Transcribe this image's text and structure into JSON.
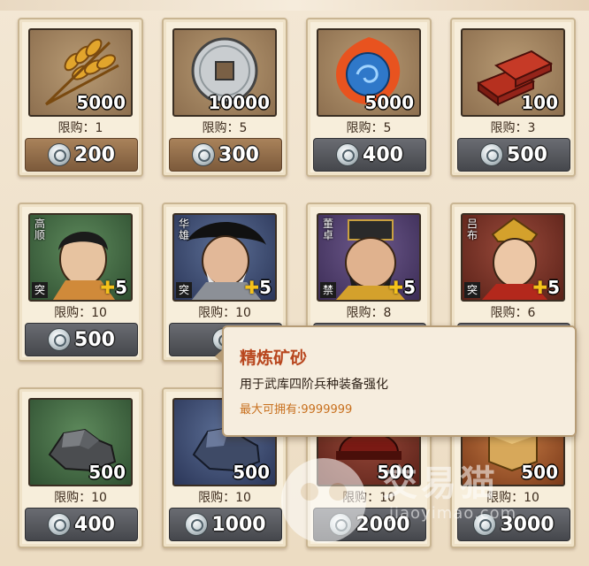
{
  "shop": {
    "items": [
      {
        "id": "wheat",
        "icon": "wheat-icon",
        "qty": "5000",
        "limit": "限购：1",
        "price": "200",
        "btn": "brown"
      },
      {
        "id": "coin",
        "icon": "silver-coin-icon",
        "qty": "10000",
        "limit": "限购：5",
        "price": "300",
        "btn": "brown"
      },
      {
        "id": "fire-orb",
        "icon": "fire-orb-icon",
        "qty": "5000",
        "limit": "限购：5",
        "price": "400",
        "btn": "gray"
      },
      {
        "id": "bricks",
        "icon": "red-bricks-icon",
        "qty": "100",
        "limit": "限购：3",
        "price": "500",
        "btn": "gray"
      },
      {
        "id": "gaoshun",
        "icon": "hero-portrait-icon",
        "hero_name": "高顺",
        "hero_type": "突",
        "stars": "5",
        "limit": "限购：10",
        "price": "500",
        "btn": "gray"
      },
      {
        "id": "huaxiong",
        "icon": "hero-portrait-icon",
        "hero_name": "华雄",
        "hero_type": "突",
        "stars": "5",
        "limit": "限购：10",
        "price": "",
        "btn": "gray"
      },
      {
        "id": "dongzhuo",
        "icon": "hero-portrait-icon",
        "hero_name": "董卓",
        "hero_type": "禁",
        "stars": "5",
        "limit": "限购：8",
        "price": "",
        "btn": "gray"
      },
      {
        "id": "lvbu",
        "icon": "hero-portrait-icon",
        "hero_name": "吕布",
        "hero_type": "突",
        "stars": "5",
        "limit": "限购：6",
        "price": "",
        "btn": "gray"
      },
      {
        "id": "ore1",
        "icon": "ore-icon",
        "qty": "500",
        "limit": "限购：10",
        "price": "400",
        "btn": "gray"
      },
      {
        "id": "ore2",
        "icon": "ore-icon",
        "qty": "500",
        "limit": "限购：10",
        "price": "1000",
        "btn": "gray"
      },
      {
        "id": "item11",
        "icon": "red-helmet-icon",
        "qty": "500",
        "limit": "限购：10",
        "price": "2000",
        "btn": "gray"
      },
      {
        "id": "item12",
        "icon": "gold-block-icon",
        "qty": "500",
        "limit": "限购：10",
        "price": "3000",
        "btn": "gray"
      }
    ]
  },
  "tooltip": {
    "title": "精炼矿砂",
    "desc": "用于武库四阶兵种装备强化",
    "max": "最大可拥有:9999999"
  },
  "watermark": {
    "text": "交易猫",
    "sub": "jiaoyimao.com"
  },
  "colors": {
    "accent": "#b8461e",
    "max_text": "#c8701e",
    "card_bg": "#f7eedb"
  }
}
